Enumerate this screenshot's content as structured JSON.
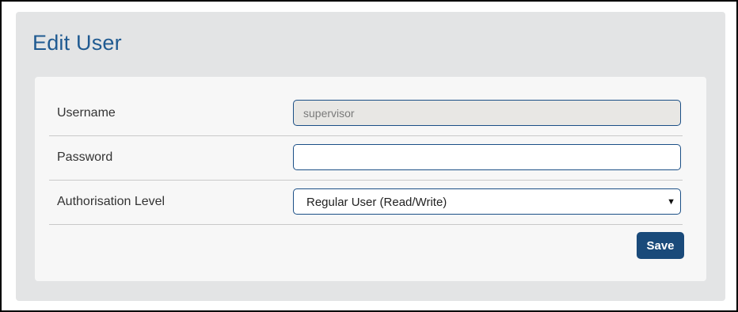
{
  "page": {
    "title": "Edit User"
  },
  "form": {
    "username": {
      "label": "Username",
      "value": "supervisor"
    },
    "password": {
      "label": "Password",
      "value": ""
    },
    "authorisation": {
      "label": "Authorisation Level",
      "selected": "Regular User (Read/Write)"
    },
    "save_label": "Save"
  },
  "icons": {
    "dropdown": "chevron-down-icon"
  },
  "colors": {
    "title": "#1f5a91",
    "accent": "#1a4a7a",
    "panel": "#e3e4e5",
    "card": "#f7f7f7"
  }
}
